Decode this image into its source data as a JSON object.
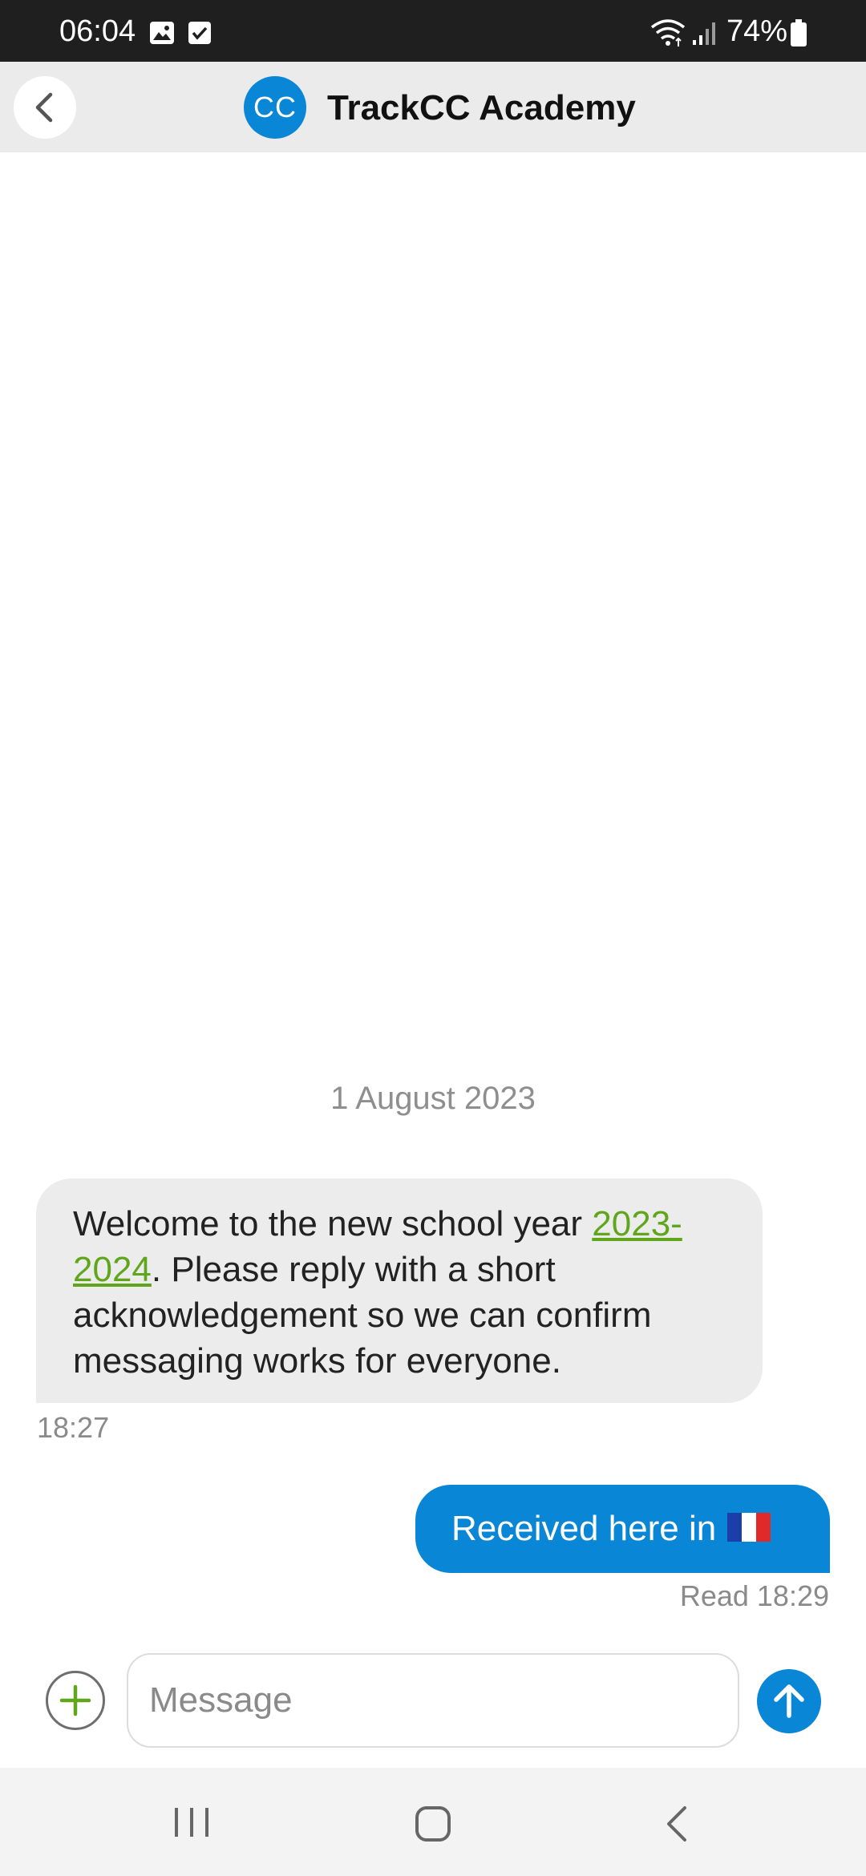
{
  "status_bar": {
    "time": "06:04",
    "battery": "74%"
  },
  "header": {
    "avatar_initials": "CC",
    "title": "TrackCC Academy"
  },
  "conversation": {
    "date_separator": "1 August 2023",
    "messages": [
      {
        "direction": "incoming",
        "text_before_link": "Welcome to the new school year ",
        "link_text": "2023-2024",
        "text_after_link": ".  Please reply with a short acknowledgement so we can confirm messaging works for everyone.",
        "time": "18:27"
      },
      {
        "direction": "outgoing",
        "text": "Received here in",
        "emoji": "french-flag",
        "status": "Read 18:29"
      }
    ]
  },
  "composer": {
    "placeholder": "Message"
  },
  "colors": {
    "accent": "#0a86d6",
    "link": "#5fa61a",
    "incoming_bubble": "#ececec",
    "header_bg": "#ebebeb"
  },
  "icons": {
    "back": "chevron-left-icon",
    "attach": "plus-icon",
    "send": "arrow-up-icon"
  }
}
